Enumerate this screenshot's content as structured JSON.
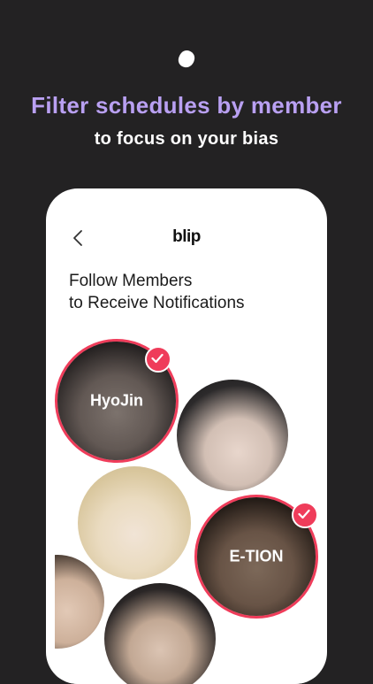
{
  "header": {
    "headline": "Filter schedules by member",
    "subline": "to focus on your bias"
  },
  "phone": {
    "app_name": "blip",
    "title_line1": "Follow Members",
    "title_line2": "to Receive Notifications"
  },
  "members": [
    {
      "name": "HyoJin",
      "selected": true
    },
    {
      "name": "",
      "selected": false
    },
    {
      "name": "",
      "selected": false
    },
    {
      "name": "E-TION",
      "selected": true
    },
    {
      "name": "",
      "selected": false
    },
    {
      "name": "",
      "selected": false
    }
  ],
  "colors": {
    "background": "#232223",
    "headline": "#b9a0f2",
    "accent": "#ef3c5a"
  },
  "icons": {
    "logo": "blob-icon",
    "back": "chevron-left-icon",
    "check": "check-icon"
  }
}
